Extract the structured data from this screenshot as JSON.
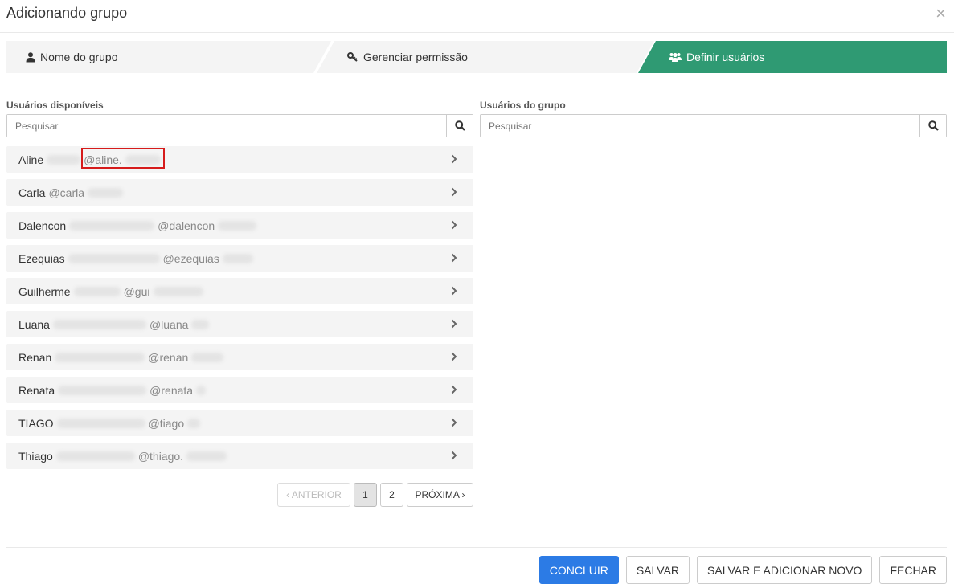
{
  "modal": {
    "title": "Adicionando grupo",
    "close_symbol": "×"
  },
  "steps": [
    {
      "label": "Nome do grupo",
      "icon": "user-icon",
      "active": false
    },
    {
      "label": "Gerenciar permissão",
      "icon": "key-icon",
      "active": false
    },
    {
      "label": "Definir usuários",
      "icon": "users-icon",
      "active": true
    }
  ],
  "colors": {
    "active_step": "#2f9a73",
    "inactive_step": "#f4f4f4",
    "primary_button": "#2c7be5",
    "highlight": "#d61b1b"
  },
  "available": {
    "label": "Usuários disponíveis",
    "search_placeholder": "Pesquisar",
    "users": [
      {
        "name": "Aline",
        "handle": "@aline."
      },
      {
        "name": "Carla",
        "handle": "@carla"
      },
      {
        "name": "Dalencon",
        "handle": "@dalencon"
      },
      {
        "name": "Ezequias",
        "handle": "@ezequias"
      },
      {
        "name": "Guilherme",
        "handle": "@gui"
      },
      {
        "name": "Luana",
        "handle": "@luana"
      },
      {
        "name": "Renan",
        "handle": "@renan"
      },
      {
        "name": "Renata",
        "handle": "@renata"
      },
      {
        "name": "TIAGO",
        "handle": "@tiago"
      },
      {
        "name": "Thiago",
        "handle": "@thiago."
      }
    ]
  },
  "group": {
    "label": "Usuários do grupo",
    "search_placeholder": "Pesquisar"
  },
  "pagination": {
    "prev": "‹ ANTERIOR",
    "pages": [
      "1",
      "2"
    ],
    "current_page": "1",
    "next": "PRÓXIMA ›"
  },
  "footer": {
    "conclude": "CONCLUIR",
    "save": "SALVAR",
    "save_new": "SALVAR E ADICIONAR NOVO",
    "close": "FECHAR"
  }
}
